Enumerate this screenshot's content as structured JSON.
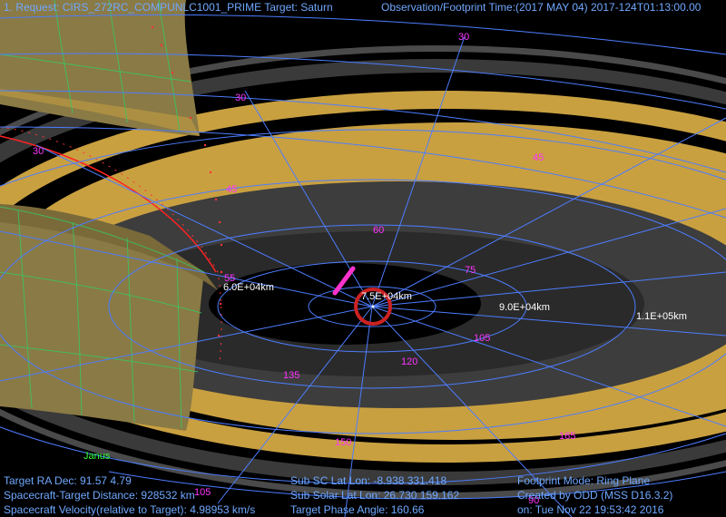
{
  "header": {
    "request": "1. Request: CIRS_272RC_COMPUNLC1001_PRIME Target: Saturn",
    "time": "Observation/Footprint Time:(2017 MAY 04) 2017-124T01:13:00.00"
  },
  "range_labels": [
    "6.0E+04km",
    "7.5E+04km",
    "9.0E+04km",
    "1.1E+05km"
  ],
  "angle_labels": {
    "a30_top": "30",
    "a30_mid": "30",
    "a30_left": "30",
    "a45_right": "45",
    "a45_left": "45",
    "a60": "60",
    "a55": "55",
    "a75": "75",
    "a105": "105",
    "a120": "120",
    "a135": "135",
    "a150": "150",
    "a165": "165",
    "a105_bottom": "105",
    "a90_bottom": "90"
  },
  "moon_label": "Janus",
  "info": {
    "ra_dec": "Target RA Dec: 91.57   4.79",
    "distance": "Spacecraft-Target Distance:  928532 km",
    "velocity": "Spacecraft Velocity(relative to Target): 4.98953 km/s",
    "sub_sc": "Sub SC Lat Lon: -8.938  331.418",
    "sub_solar": "Sub Solar Lat Lon: 26.730  159.162",
    "phase": "Target Phase Angle: 160.66",
    "mode": "Footprint Mode: Ring Plane",
    "created": "Created by ODD (MSS D16.3.2)",
    "date": "on: Tue Nov 22 19:53:42 2016"
  },
  "colors": {
    "ring_gold": "#c9a040",
    "ring_dark": "#3d3d3d",
    "grid_blue": "#4d7dff",
    "planet_olive": "#8a7a45",
    "text_blue": "#6fa8ff",
    "footprint_red": "#cc2222",
    "detector_magenta": "#ff33cc"
  }
}
